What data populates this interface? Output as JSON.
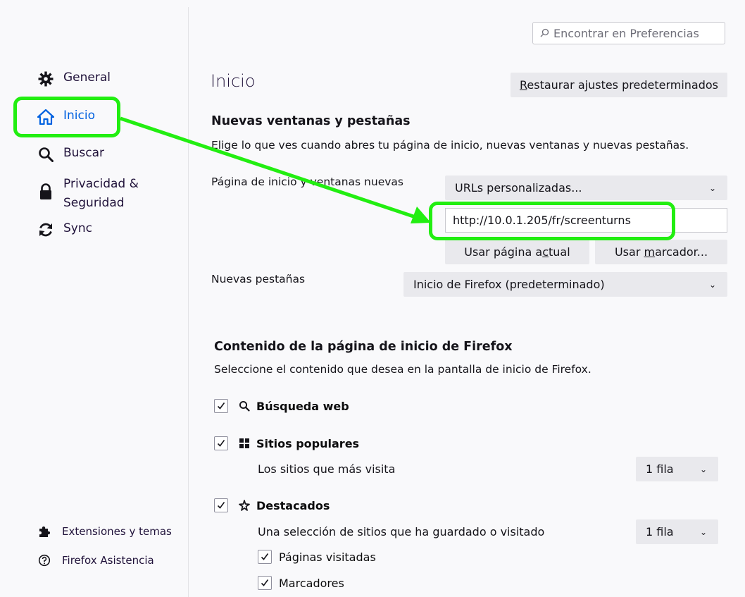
{
  "search": {
    "placeholder": "Encontrar en Preferencias"
  },
  "sidebar": {
    "items": [
      {
        "label": "General",
        "icon": "gear-icon"
      },
      {
        "label": "Inicio",
        "icon": "home-icon",
        "active": true
      },
      {
        "label": "Buscar",
        "icon": "search-icon"
      },
      {
        "label": "Privacidad &",
        "label2": "Seguridad",
        "icon": "lock-icon"
      },
      {
        "label": "Sync",
        "icon": "sync-icon"
      }
    ],
    "footer": [
      {
        "label": "Extensiones y temas",
        "icon": "puzzle-icon"
      },
      {
        "label": "Firefox Asistencia",
        "icon": "help-icon"
      }
    ]
  },
  "main": {
    "title": "Inicio",
    "restore_prefix": "",
    "restore_underlined": "R",
    "restore_rest": "estaurar ajustes predeterminados",
    "new_windows": {
      "heading": "Nuevas ventanas y pestañas",
      "description": "Elige lo que ves cuando abres tu página de inicio, nuevas ventanas y nuevas pestañas.",
      "homepage_label": "Página de inicio y ventanas nuevas",
      "homepage_select": "URLs personalizadas...",
      "homepage_url": "http://10.0.1.205/fr/screenturns",
      "use_current_a": "Usar página a",
      "use_current_u": "c",
      "use_current_b": "tual",
      "use_bookmark_a": "Usar ",
      "use_bookmark_u": "m",
      "use_bookmark_b": "arcador...",
      "newtabs_label": "Nuevas pestañas",
      "newtabs_select": "Inicio de Firefox (predeterminado)"
    },
    "home_content": {
      "heading": "Contenido de la página de inicio de Firefox",
      "description": "Seleccione el contenido que desea en la pantalla de inicio de Firefox.",
      "web_search": "Búsqueda web",
      "top_sites": "Sitios populares",
      "top_sites_desc": "Los sitios que más visita",
      "top_sites_rows": "1 fila",
      "highlights": "Destacados",
      "highlights_desc": "Una selección de sitios que ha guardado o visitado",
      "highlights_rows": "1 fila",
      "visited_pages": "Páginas visitadas",
      "bookmarks": "Marcadores"
    }
  },
  "colors": {
    "accent": "#0061e0",
    "annotation": "#22ee11"
  }
}
